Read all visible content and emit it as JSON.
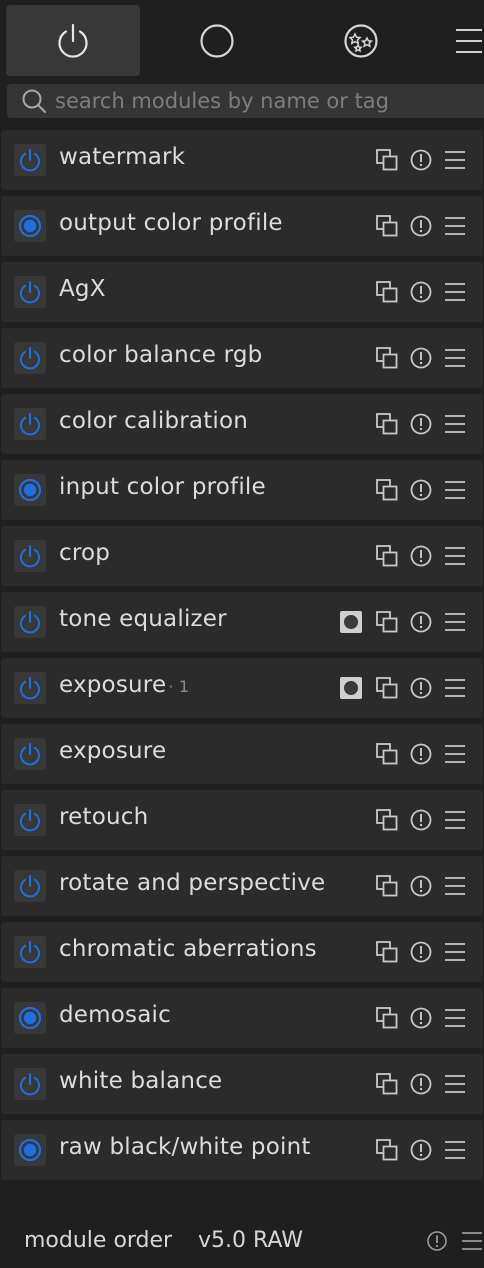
{
  "tabs": [
    {
      "name": "active-modules",
      "icon": "power-icon",
      "active": true
    },
    {
      "name": "favorite-modules",
      "icon": "circle-icon",
      "active": false
    },
    {
      "name": "all-modules",
      "icon": "stars-icon",
      "active": false
    },
    {
      "name": "presets-menu",
      "icon": "hamburger-icon",
      "active": false
    }
  ],
  "search": {
    "placeholder": "search modules by name or tag",
    "icon": "search-icon"
  },
  "modules": [
    {
      "name": "watermark",
      "instance": "",
      "enabled": false,
      "mask": false
    },
    {
      "name": "output color profile",
      "instance": "",
      "enabled": true,
      "mask": false
    },
    {
      "name": "AgX",
      "instance": "",
      "enabled": false,
      "mask": false
    },
    {
      "name": "color balance rgb",
      "instance": "",
      "enabled": false,
      "mask": false
    },
    {
      "name": "color calibration",
      "instance": "",
      "enabled": false,
      "mask": false
    },
    {
      "name": "input color profile",
      "instance": "",
      "enabled": true,
      "mask": false
    },
    {
      "name": "crop",
      "instance": "",
      "enabled": false,
      "mask": false
    },
    {
      "name": "tone equalizer",
      "instance": "",
      "enabled": false,
      "mask": true
    },
    {
      "name": "exposure",
      "instance": "· 1",
      "enabled": false,
      "mask": true
    },
    {
      "name": "exposure",
      "instance": "",
      "enabled": false,
      "mask": false
    },
    {
      "name": "retouch",
      "instance": "",
      "enabled": false,
      "mask": false
    },
    {
      "name": "rotate and perspective",
      "instance": "",
      "enabled": false,
      "mask": false
    },
    {
      "name": "chromatic aberrations",
      "instance": "",
      "enabled": false,
      "mask": false
    },
    {
      "name": "demosaic",
      "instance": "",
      "enabled": true,
      "mask": false
    },
    {
      "name": "white balance",
      "instance": "",
      "enabled": false,
      "mask": false
    },
    {
      "name": "raw black/white point",
      "instance": "",
      "enabled": true,
      "mask": false
    }
  ],
  "module_icons": {
    "multi_instance": "multi-instance-icon",
    "reset": "reset-icon",
    "presets": "presets-icon",
    "mask": "mask-icon",
    "power": "power-icon"
  },
  "footer": {
    "label": "module order",
    "value": "v5.0 RAW"
  },
  "colors": {
    "accent": "#1f6fe0",
    "panel_bg": "#1f1f1f",
    "module_bg": "#2b2b2b",
    "text": "#dcdcdc",
    "icon": "#c8c8c8"
  }
}
